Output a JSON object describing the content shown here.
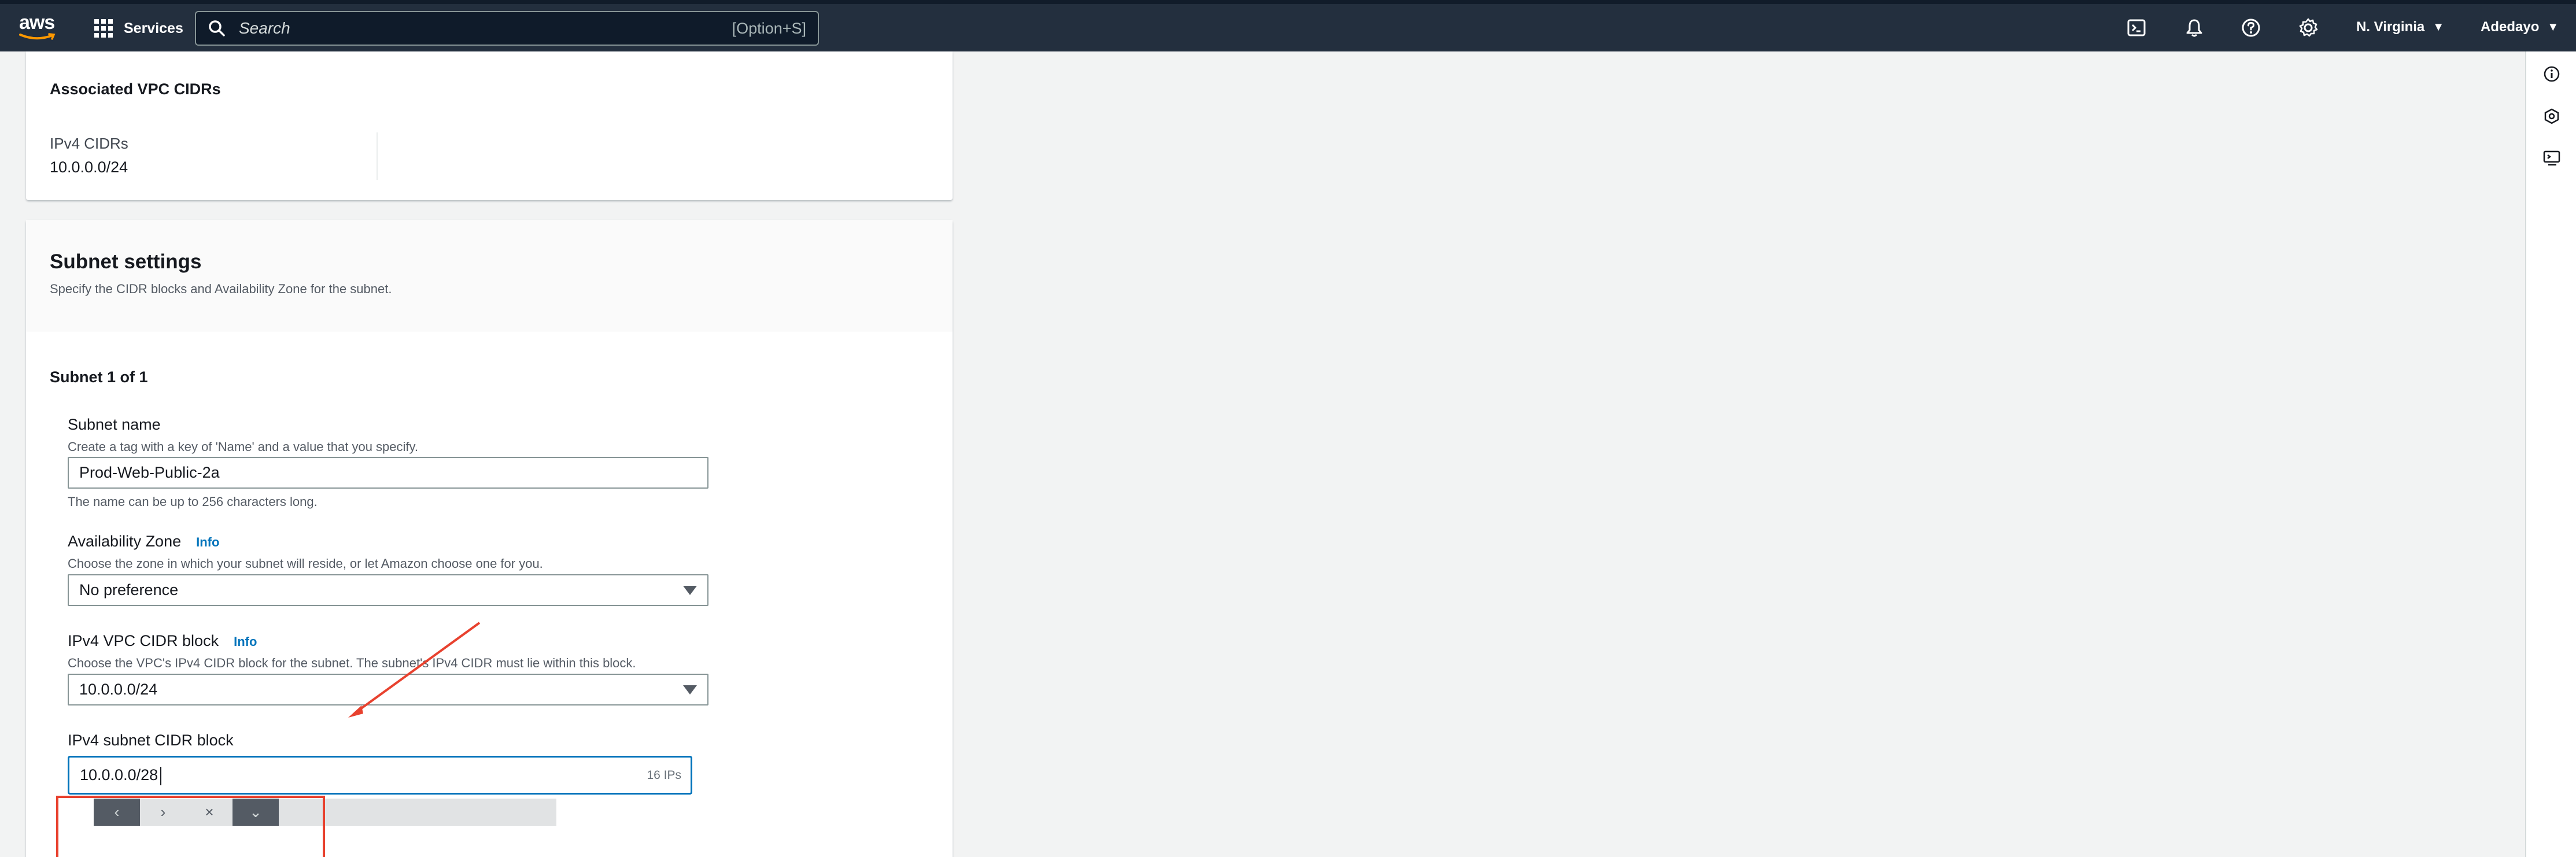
{
  "nav": {
    "logo_text": "aws",
    "services_label": "Services",
    "search_placeholder": "Search",
    "search_shortcut": "[Option+S]",
    "region_label": "N. Virginia",
    "user_label": "Adedayo",
    "icons": [
      "cloudshell-icon",
      "bell-icon",
      "help-icon",
      "gear-icon"
    ]
  },
  "associated_cidrs": {
    "title": "Associated VPC CIDRs",
    "ipv4_label": "IPv4 CIDRs",
    "ipv4_value": "10.0.0.0/24"
  },
  "subnet_settings": {
    "title": "Subnet settings",
    "description": "Specify the CIDR blocks and Availability Zone for the subnet.",
    "subnet_counter": "Subnet 1 of 1",
    "subnet_name": {
      "label": "Subnet name",
      "description": "Create a tag with a key of 'Name' and a value that you specify.",
      "value": "Prod-Web-Public-2a",
      "hint": "The name can be up to 256 characters long."
    },
    "availability_zone": {
      "label": "Availability Zone",
      "info": "Info",
      "description": "Choose the zone in which your subnet will reside, or let Amazon choose one for you.",
      "value": "No preference"
    },
    "vpc_cidr_block": {
      "label": "IPv4 VPC CIDR block",
      "info": "Info",
      "description": "Choose the VPC's IPv4 CIDR block for the subnet. The subnet's IPv4 CIDR must lie within this block.",
      "value": "10.0.0.0/24"
    },
    "subnet_cidr_block": {
      "label": "IPv4 subnet CIDR block",
      "value": "10.0.0.0/28",
      "ip_count": "16 IPs"
    },
    "stepper_buttons": [
      "‹",
      "›",
      "×",
      "⌄"
    ]
  },
  "right_rail": {
    "icons": [
      "info-icon",
      "feedback-icon",
      "cloudshell-panel-icon"
    ]
  },
  "colors": {
    "nav_bg": "#232f3e",
    "link": "#0073bb",
    "focus_border": "#0073bb",
    "annotation": "#e8412e"
  }
}
